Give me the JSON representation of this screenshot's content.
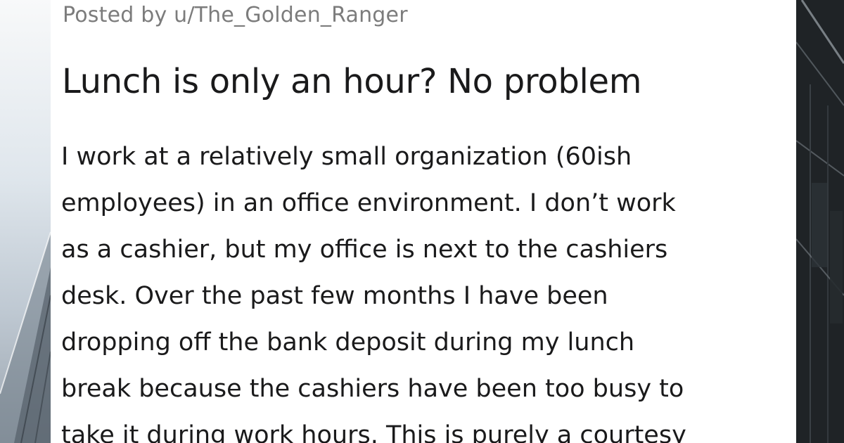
{
  "post": {
    "posted_by": "Posted by u/The_Golden_Ranger",
    "title": "Lunch is only an hour? No problem",
    "body_lines": [
      "I work at a relatively small organization (60ish",
      "employees) in an office environment. I don’t work",
      "as a cashier, but my office is next to the cashiers",
      "desk. Over the past few months I have been",
      "dropping off the bank deposit during my lunch",
      "break because the cashiers have been too busy to",
      "take it during work hours. This is purely a courtesy"
    ]
  },
  "colors": {
    "card_background": "#ffffff",
    "meta_text": "#7c7c7c",
    "body_text": "#1a1a1b",
    "left_background": "#dfe5ea",
    "right_background": "#1c1f22"
  }
}
